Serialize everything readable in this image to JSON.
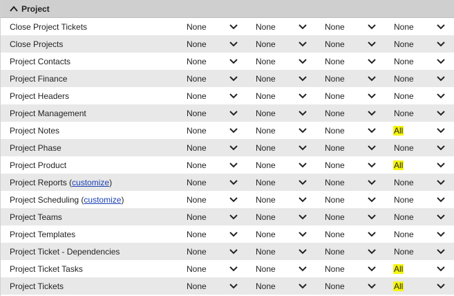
{
  "section": {
    "title": "Project"
  },
  "rows": [
    {
      "name": "Close Project Tickets",
      "values": [
        "None",
        "None",
        "None",
        "None"
      ]
    },
    {
      "name": "Close Projects",
      "values": [
        "None",
        "None",
        "None",
        "None"
      ]
    },
    {
      "name": "Project Contacts",
      "values": [
        "None",
        "None",
        "None",
        "None"
      ]
    },
    {
      "name": "Project Finance",
      "values": [
        "None",
        "None",
        "None",
        "None"
      ]
    },
    {
      "name": "Project Headers",
      "values": [
        "None",
        "None",
        "None",
        "None"
      ]
    },
    {
      "name": "Project Management",
      "values": [
        "None",
        "None",
        "None",
        "None"
      ]
    },
    {
      "name": "Project Notes",
      "values": [
        "None",
        "None",
        "None",
        "All"
      ]
    },
    {
      "name": "Project Phase",
      "values": [
        "None",
        "None",
        "None",
        "None"
      ]
    },
    {
      "name": "Project Product",
      "values": [
        "None",
        "None",
        "None",
        "All"
      ]
    },
    {
      "name": "Project Reports",
      "link": "customize",
      "values": [
        "None",
        "None",
        "None",
        "None"
      ]
    },
    {
      "name": "Project Scheduling",
      "link": "customize",
      "values": [
        "None",
        "None",
        "None",
        "None"
      ]
    },
    {
      "name": "Project Teams",
      "values": [
        "None",
        "None",
        "None",
        "None"
      ]
    },
    {
      "name": "Project Templates",
      "values": [
        "None",
        "None",
        "None",
        "None"
      ]
    },
    {
      "name": "Project Ticket - Dependencies",
      "values": [
        "None",
        "None",
        "None",
        "None"
      ]
    },
    {
      "name": "Project Ticket Tasks",
      "values": [
        "None",
        "None",
        "None",
        "All"
      ]
    },
    {
      "name": "Project Tickets",
      "values": [
        "None",
        "None",
        "None",
        "All"
      ]
    }
  ],
  "colors": {
    "header_bg": "#cfcfcf",
    "alt_row_bg": "#e8e8e8",
    "highlight": "#f5f50f",
    "link": "#1a3fb5"
  },
  "icons": {
    "collapse": "chevron-up-icon",
    "dropdown": "chevron-down-icon"
  }
}
